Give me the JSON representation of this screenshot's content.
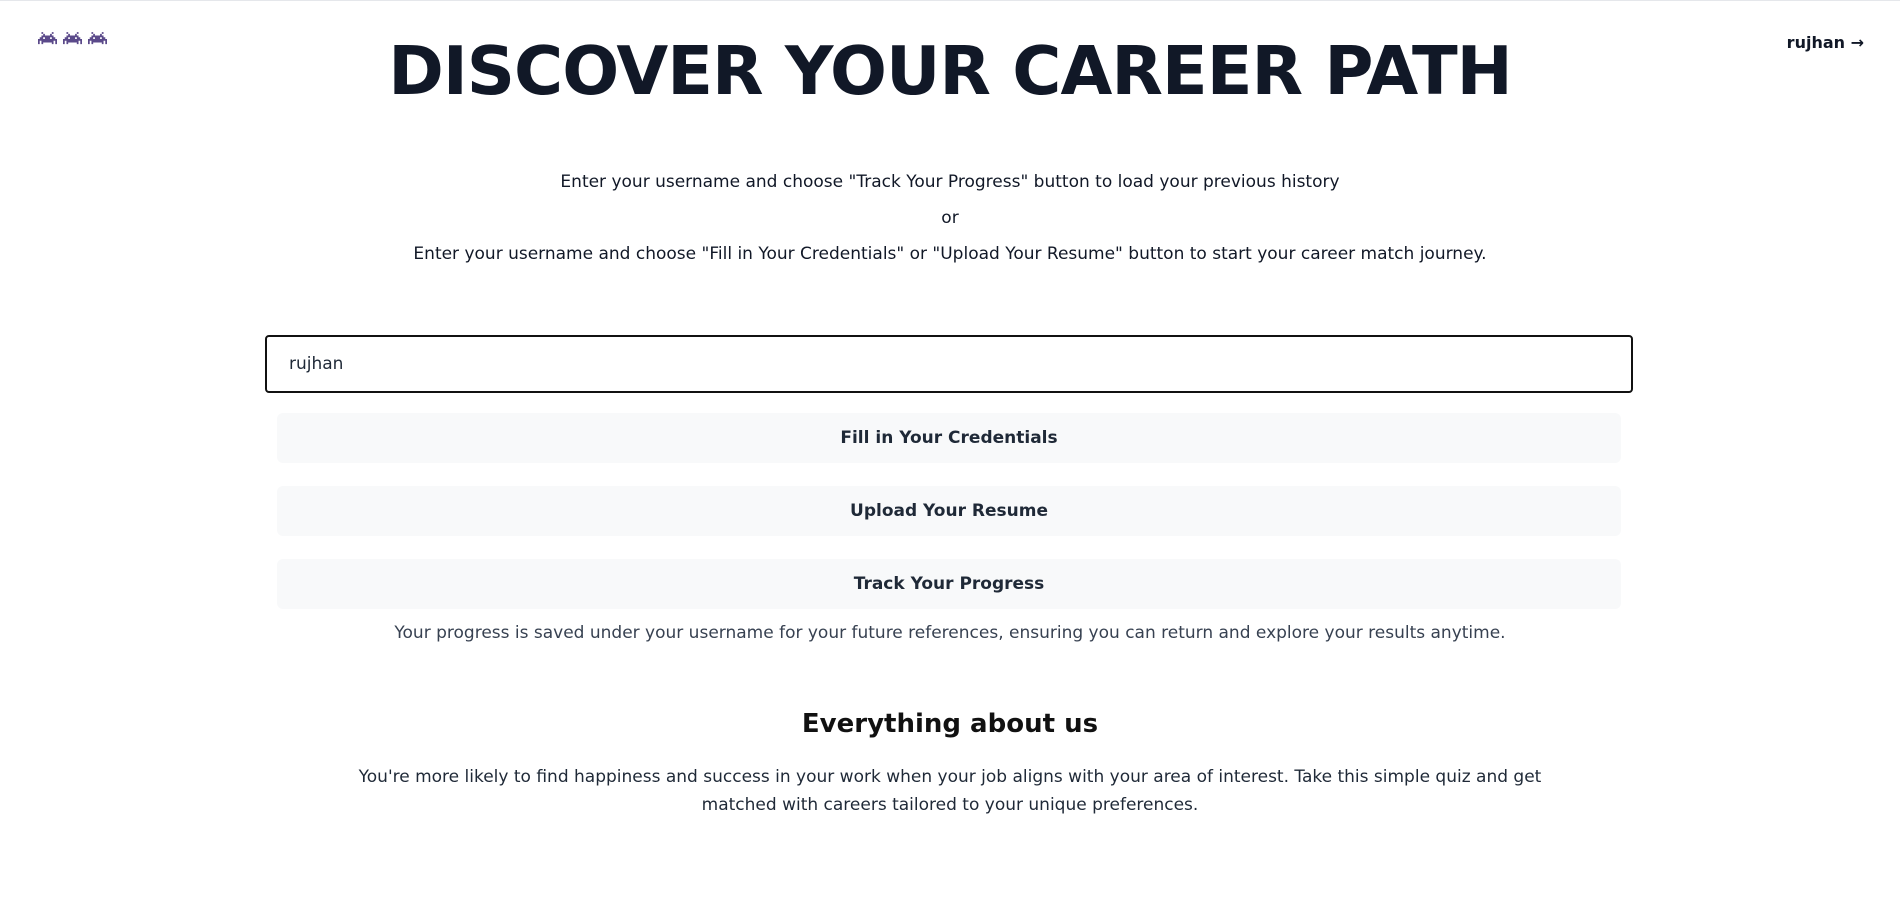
{
  "header": {
    "logo_icons": [
      "invader-icon",
      "invader-icon",
      "invader-icon"
    ],
    "user_link": "rujhan →"
  },
  "hero": {
    "title": "DISCOVER YOUR CAREER PATH",
    "instruction_1": "Enter your username and choose \"Track Your Progress\" button to load your previous history",
    "or_text": "or",
    "instruction_2": "Enter your username and choose \"Fill in Your Credentials\" or \"Upload Your Resume\" button to start your career match journey."
  },
  "form": {
    "username_value": "rujhan",
    "fill_credentials_label": "Fill in Your Credentials",
    "upload_resume_label": "Upload Your Resume",
    "track_progress_label": "Track Your Progress",
    "saved_note": "Your progress is saved under your username for your future references, ensuring you can return and explore your results anytime."
  },
  "about": {
    "heading": "Everything about us",
    "text": "You're more likely to find happiness and success in your work when your job aligns with your area of interest. Take this simple quiz and get matched with careers tailored to your unique preferences."
  },
  "colors": {
    "logo_icon": "#5b4a8a",
    "title": "#111827",
    "button_bg": "#f8f9fa",
    "input_border": "#111111"
  }
}
